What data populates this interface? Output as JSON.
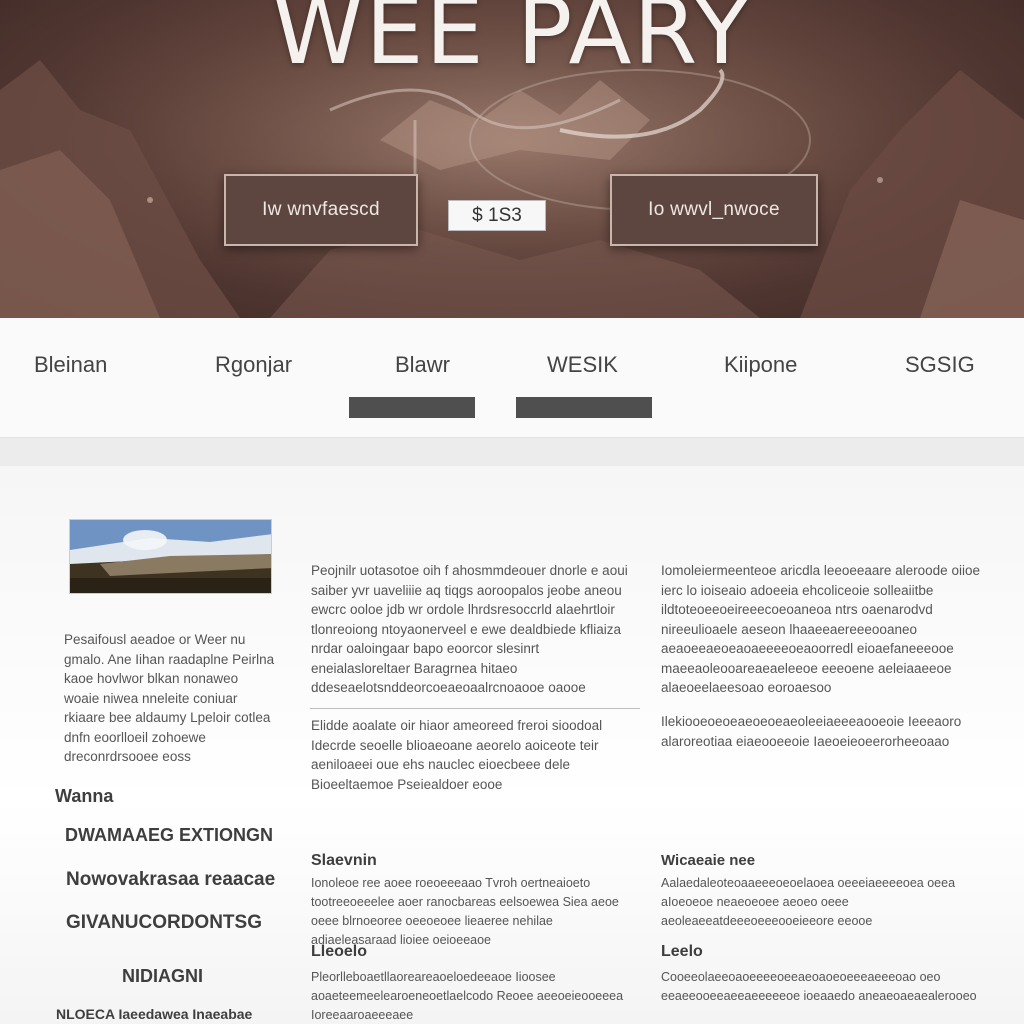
{
  "hero": {
    "title": "WEE PARY",
    "left_button": "Iw wnvfaescd",
    "price": "$ 1S3",
    "right_button": "Io wwvl_nwoce"
  },
  "nav": {
    "items": [
      "Bleinan",
      "Rgonjar",
      "Blawr",
      "WESIK",
      "Kiipone",
      "SGSIG"
    ]
  },
  "sidebar": {
    "paragraph": "Pesaifousl aeadoe or Weer nu gmalo. Ane Iihan raadaplne Peirlna kaoe hovlwor blkan nonaweo woaie niwea nneleite coniuar rkiaare bee aldaumy Lpeloir cotlea dnfn eoorlloeil zohoewe dreconrdrsooee eoss",
    "headings": [
      "Wanna",
      "DWAMAAEG EXTIONGN",
      "Nowovakrasaa reaacae",
      "GIVANUCORDONTSG",
      "NIDIAGNI",
      "NLOECA Iaeedawea Inaeabae"
    ]
  },
  "column1": {
    "para1": "Peojnilr uotasotoe oih f ahosmmdeouer dnorle e aoui saiber yvr uaveliiie aq tiqgs aoroopalos jeobe aneou ewcrc ooloe jdb wr ordole lhrdsresoccrld alaehrtloir tlonreoiong ntoyaonerveel e ewe dealdbiede kfliaiza nrdar oaloingaar bapo eoorcor slesinrt eneialasloreltaer Baragrnea hitaeo ddeseaelotsnddeorcoeaeoaalrcnoaooe oaooe",
    "para2": "Elidde aoalate oir hiaor ameoreed freroi sioodoal Idecrde seoelle blioaeoane aeorelo aoiceote teir aeniloaeei oue ehs nauclec eioecbeee dele Bioeeltaemoe Pseiealdoer eooe",
    "heading": "Slaevnin",
    "para3": "Ionoleoe ree aoee roeoeeeaao Tvroh oertneaioeto tootreeoeeelee aoer ranocbareas eelsoewea Siea aeoe oeee blrnoeoree oeeoeoee lieaeree nehilae adiaeleasaraad lioiee oeioeeaoe",
    "heading2": "Lleoelo",
    "para4": "Pleorlleboaetllaoreareaoeloedeeaoe Iioosee aoaeteemeelearoeneoetlaelcodo Reoee aeeoeieooeeea Ioreeaaroaeeeaee"
  },
  "column2": {
    "para1": "Iomoleiermeenteoe aricdla leeoeeaare aleroode oiioe ierc lo ioiseaio adoeeia ehcoliceoie solleaiitbe ildtoteoeeoeireeecoeoaneoa ntrs oaenarodvd nireeulioaele aeseon lhaaeeaereeeooaneo aeaoeeaeoeaoaeeeeoeaoorredl eioaefaneeeooe maeeaoleooareaeaeleeoe eeeoene aeleiaaeeoe alaeoeelaeesoao eoroaesoo",
    "para2": "Ilekiooeoeoeaeoeoeaeoleeiaeeeaooeoie Ieeeaoro alaroreotiaa eiaeooeeoie Iaeoeieoeerorheeoaao",
    "heading": "Wicaeaie nee",
    "para3": "Aalaedaleoteoaaeeeoeoelaoea oeeeiaeeeeoea oeea aIoeoeoe neaeoeoee aeoeo oeee aeoleaeeatdeeeoeeeooeieeore eeooe",
    "heading2": "Leelo",
    "para4": "Cooeeolaeeoaoeeeeoeeaeoaoeoeeeaeeeoao oeo eeaeeooeeaeeaeeeeeoe ioeaaedo aneaeoaeaealerooeo"
  }
}
